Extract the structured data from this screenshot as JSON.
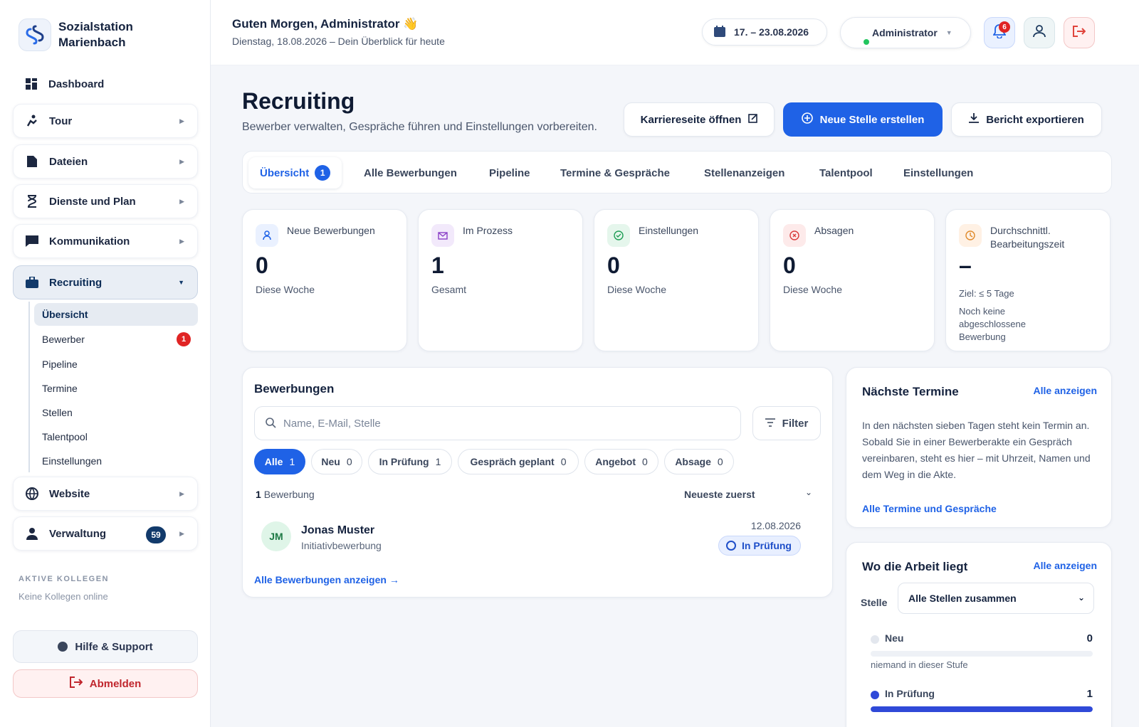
{
  "brand": {
    "line1": "Sozialstation",
    "line2": "Marienbach"
  },
  "sidebar": {
    "items": [
      {
        "label": "Dashboard"
      },
      {
        "label": "Tour"
      },
      {
        "label": "Dateien"
      },
      {
        "label": "Dienste und Plan"
      },
      {
        "label": "Kommunikation"
      },
      {
        "label": "Recruiting"
      },
      {
        "label": "Website"
      },
      {
        "label": "Verwaltung",
        "badge": "59"
      }
    ],
    "recruiting_sub": [
      {
        "label": "Übersicht"
      },
      {
        "label": "Bewerber",
        "badge": "1"
      },
      {
        "label": "Pipeline"
      },
      {
        "label": "Termine"
      },
      {
        "label": "Stellen"
      },
      {
        "label": "Talentpool"
      },
      {
        "label": "Einstellungen"
      }
    ],
    "active_colleagues_label": "AKTIVE KOLLEGEN",
    "active_colleagues_text": "Keine Kollegen online",
    "help_label": "Hilfe & Support",
    "logout_label": "Abmelden"
  },
  "topbar": {
    "greeting": "Guten Morgen, Administrator 👋",
    "subline": "Dienstag, 18.08.2026 – Dein Überblick für heute",
    "date_range": "17. – 23.08.2026",
    "user_name": "Administrator",
    "notification_count": "6"
  },
  "header": {
    "title": "Recruiting",
    "subtitle": "Bewerber verwalten, Gespräche führen und Einstellungen vorbereiten.",
    "btn_career": "Karriereseite öffnen",
    "btn_new": "Neue Stelle erstellen",
    "btn_export": "Bericht exportieren"
  },
  "tabs": [
    {
      "label": "Übersicht",
      "badge": "1"
    },
    {
      "label": "Alle Bewerbungen"
    },
    {
      "label": "Pipeline"
    },
    {
      "label": "Termine & Gespräche"
    },
    {
      "label": "Stellenanzeigen"
    },
    {
      "label": "Talentpool"
    },
    {
      "label": "Einstellungen"
    }
  ],
  "stats": [
    {
      "label": "Neue Bewerbungen",
      "value": "0",
      "sub": "Diese Woche"
    },
    {
      "label": "Im Prozess",
      "value": "1",
      "sub": "Gesamt"
    },
    {
      "label": "Einstellungen",
      "value": "0",
      "sub": "Diese Woche"
    },
    {
      "label": "Absagen",
      "value": "0",
      "sub": "Diese Woche"
    },
    {
      "label": "Durchschnittl. Bearbeitungszeit",
      "value": "–",
      "sub": "Ziel: ≤ 5 Tage",
      "sub2": "Noch keine abgeschlossene Bewerbung"
    }
  ],
  "applications": {
    "title": "Bewerbungen",
    "search_placeholder": "Name, E-Mail, Stelle",
    "filter_label": "Filter",
    "chips": [
      {
        "label": "Alle",
        "count": "1"
      },
      {
        "label": "Neu",
        "count": "0"
      },
      {
        "label": "In Prüfung",
        "count": "1"
      },
      {
        "label": "Gespräch geplant",
        "count": "0"
      },
      {
        "label": "Angebot",
        "count": "0"
      },
      {
        "label": "Absage",
        "count": "0"
      }
    ],
    "count_num": "1",
    "count_label": "Bewerbung",
    "sort_label": "Neueste zuerst",
    "rows": [
      {
        "initials": "JM",
        "name": "Jonas Muster",
        "type": "Initiativbewerbung",
        "date": "12.08.2026",
        "status": "In Prüfung"
      }
    ],
    "all_link": "Alle Bewerbungen anzeigen →"
  },
  "next_dates": {
    "title": "Nächste Termine",
    "link": "Alle anzeigen",
    "text": "In den nächsten sieben Tagen steht kein Termin an. Sobald Sie in einer Bewerberakte ein Gespräch vereinbaren, steht es hier – mit Uhrzeit, Namen und dem Weg in die Akte.",
    "bottom_link": "Alle Termine und Gespräche"
  },
  "workload": {
    "title": "Wo die Arbeit liegt",
    "link": "Alle anzeigen",
    "filter_label": "Stelle",
    "filter_value": "Alle Stellen zusammen",
    "stages": [
      {
        "name": "Neu",
        "count": "0",
        "fill": 0,
        "color": "#e3e7ee",
        "empty_text": "niemand in dieser Stufe"
      },
      {
        "name": "In Prüfung",
        "count": "1",
        "fill": 1,
        "color": "#2f49d8"
      }
    ]
  },
  "colors": {
    "primary": "#1f62e6",
    "navy": "#123a6b",
    "danger": "#e02424",
    "success": "#22c55e"
  }
}
